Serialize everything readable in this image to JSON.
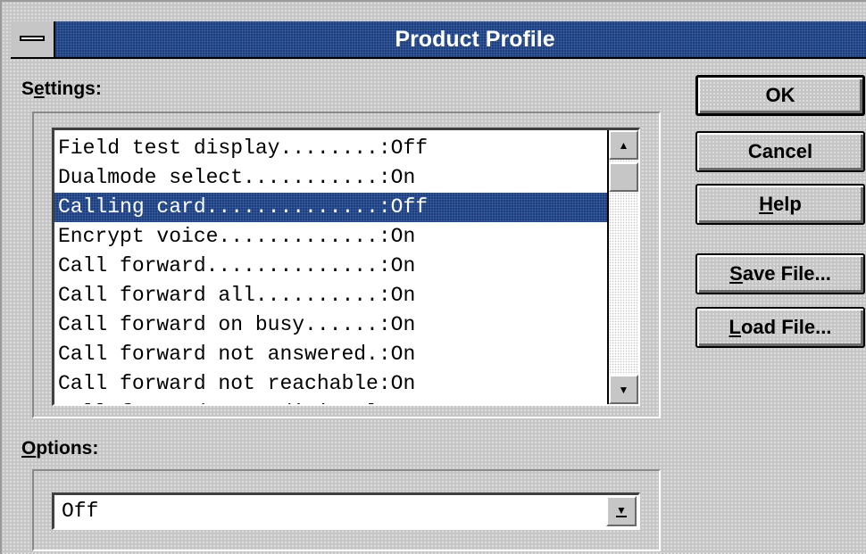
{
  "window": {
    "title": "Product Profile"
  },
  "settings": {
    "label_mnemonic": "S",
    "label_underlined": "e",
    "label_rest": "ttings:",
    "items": [
      {
        "text": "Field test display........:Off",
        "selected": false
      },
      {
        "text": "Dualmode select...........:On",
        "selected": false
      },
      {
        "text": "Calling card..............:Off",
        "selected": true
      },
      {
        "text": "Encrypt voice.............:On",
        "selected": false
      },
      {
        "text": "Call forward..............:On",
        "selected": false
      },
      {
        "text": "Call forward all..........:On",
        "selected": false
      },
      {
        "text": "Call forward on busy......:On",
        "selected": false
      },
      {
        "text": "Call forward not answered.:On",
        "selected": false
      },
      {
        "text": "Call forward not reachable:On",
        "selected": false
      },
      {
        "text": "Call forward unconditional:On",
        "selected": false
      }
    ]
  },
  "options": {
    "label_underlined": "O",
    "label_rest": "ptions:",
    "value": "Off"
  },
  "buttons": {
    "ok": "OK",
    "cancel": "Cancel",
    "help_mnemonic": "H",
    "help_rest": "elp",
    "save_mnemonic": "S",
    "save_rest": "ave File...",
    "load_mnemonic": "L",
    "load_rest": "oad File..."
  },
  "icons": {
    "scroll_up": "▲",
    "scroll_down": "▼",
    "dropdown": "▼"
  },
  "colors": {
    "title_bar": "#1f3f7a",
    "selection": "#1f3f7a",
    "face": "#c6c6c6"
  }
}
